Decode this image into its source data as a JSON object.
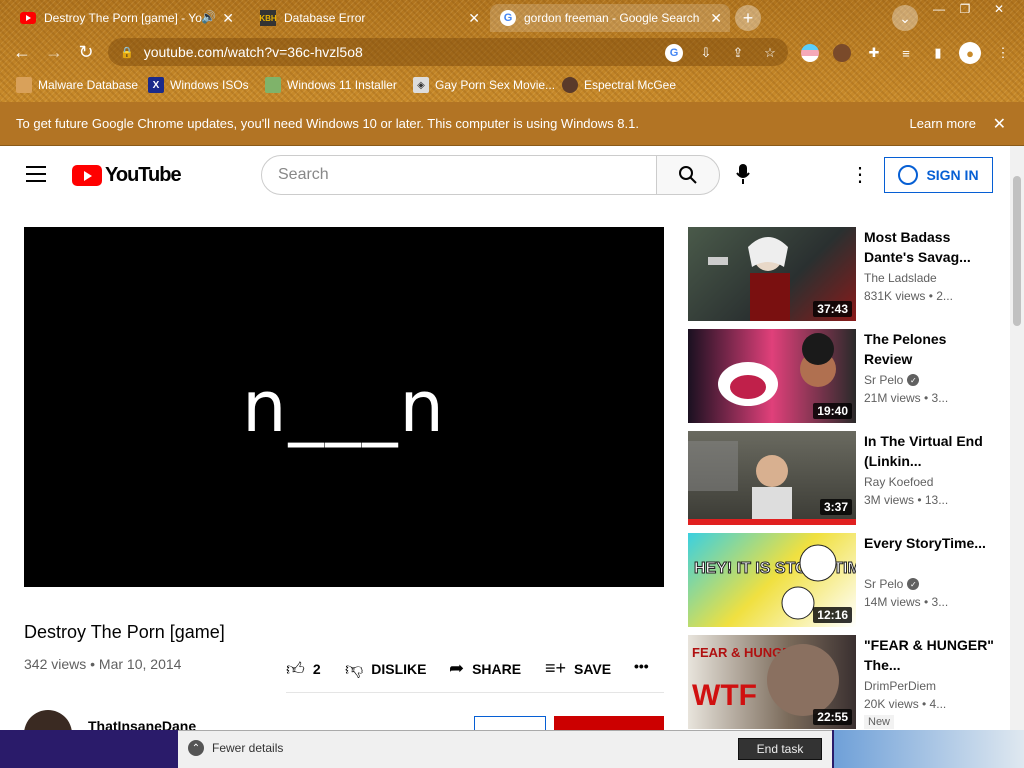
{
  "browser": {
    "tabs": [
      {
        "title": "Destroy The Porn [game] - Yo",
        "icon": "youtube-icon"
      },
      {
        "title": "Database Error",
        "icon": "kbh-icon"
      },
      {
        "title": "gordon freeman - Google Search",
        "icon": "google-icon"
      }
    ],
    "url": "youtube.com/watch?v=36c-hvzl5o8",
    "bookmarks": [
      {
        "label": "Malware Database"
      },
      {
        "label": "Windows ISOs"
      },
      {
        "label": "Windows 11 Installer"
      },
      {
        "label": "Gay Porn Sex Movie..."
      },
      {
        "label": "Espectral McGee"
      }
    ],
    "infobar": {
      "message": "To get future Google Chrome updates, you'll need Windows 10 or later. This computer is using Windows 8.1.",
      "learn_more": "Learn more"
    }
  },
  "youtube": {
    "logo_text": "YouTube",
    "search_placeholder": "Search",
    "sign_in": "SIGN IN",
    "video": {
      "player_text": "n___n",
      "title": "Destroy The Porn [game]",
      "meta": "342 views • Mar 10, 2014",
      "likes": "2",
      "dislike": "DISLIKE",
      "share": "SHARE",
      "save": "SAVE",
      "channel": "ThatInsaneDane"
    },
    "recommendations": [
      {
        "title": "Most Badass Dante's Savag...",
        "channel": "The Ladslade",
        "views": "831K views  • 2...",
        "duration": "37:43",
        "verified": false
      },
      {
        "title": "The Pelones Review",
        "channel": "Sr Pelo",
        "views": "21M views  • 3...",
        "duration": "19:40",
        "verified": true
      },
      {
        "title": "In The Virtual End (Linkin...",
        "channel": "Ray Koefoed",
        "views": "3M views  • 13...",
        "duration": "3:37",
        "verified": false
      },
      {
        "title": "Every StoryTime...",
        "channel": "Sr Pelo",
        "views": "14M views  • 3...",
        "duration": "12:16",
        "verified": true
      },
      {
        "title": "\"FEAR & HUNGER\" The...",
        "channel": "DrimPerDiem",
        "views": "20K views  • 4...",
        "duration": "22:55",
        "verified": false,
        "badge": "New"
      }
    ],
    "thumb_texts": {
      "storytime": "HEY! IT IS STORY TIME!",
      "fear": "FEAR & HUNGER",
      "wtf": "WTF"
    }
  },
  "taskmanager": {
    "fewer_details": "Fewer details",
    "end_task": "End task"
  }
}
